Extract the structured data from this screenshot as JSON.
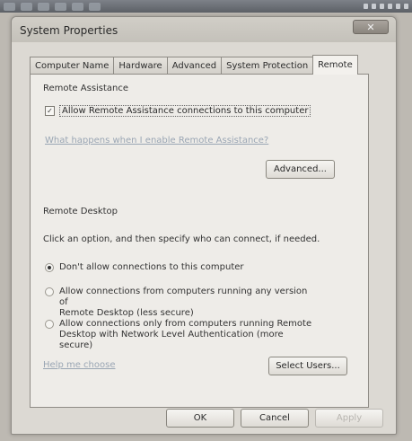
{
  "window": {
    "title": "System Properties",
    "close_glyph": "✕"
  },
  "tabs": [
    {
      "label": "Computer Name",
      "active": false
    },
    {
      "label": "Hardware",
      "active": false
    },
    {
      "label": "Advanced",
      "active": false
    },
    {
      "label": "System Protection",
      "active": false
    },
    {
      "label": "Remote",
      "active": true
    }
  ],
  "remote_assistance": {
    "heading": "Remote Assistance",
    "checkbox_label": "Allow Remote Assistance connections to this computer",
    "checked": true,
    "check_glyph": "✓",
    "link": "What happens when I enable Remote Assistance?",
    "advanced_button": "Advanced..."
  },
  "remote_desktop": {
    "heading": "Remote Desktop",
    "instruction": "Click an option, and then specify who can connect, if needed.",
    "options": [
      {
        "line1": "Don't allow connections to this computer",
        "line2": "",
        "checked": true
      },
      {
        "line1": "Allow connections from computers running any version of",
        "line2": "Remote Desktop (less secure)",
        "checked": false
      },
      {
        "line1": "Allow connections only from computers running Remote",
        "line2": "Desktop with Network Level Authentication (more secure)",
        "checked": false
      }
    ],
    "help_link": "Help me choose",
    "select_users_button": "Select Users..."
  },
  "footer": {
    "ok": "OK",
    "cancel": "Cancel",
    "apply": "Apply"
  },
  "colors": {
    "link": "#9aa6b4",
    "window_bg": "#dcd9d3",
    "panel_bg": "#eeece8"
  }
}
